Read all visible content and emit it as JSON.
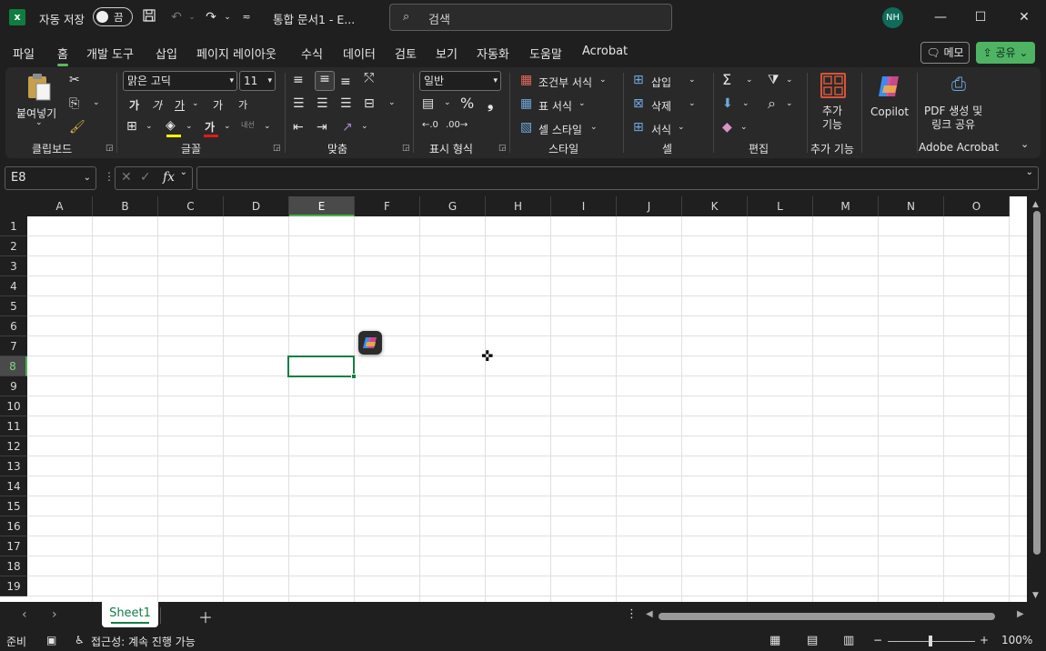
{
  "titlebar": {
    "autosave_label": "자동 저장",
    "autosave_state": "끔",
    "doc_title": "통합 문서1 - E...",
    "search_placeholder": "검색",
    "avatar_initials": "NH"
  },
  "tabs": [
    "파일",
    "홈",
    "개발 도구",
    "삽입",
    "페이지 레이아웃",
    "수식",
    "데이터",
    "검토",
    "보기",
    "자동화",
    "도움말",
    "Acrobat"
  ],
  "active_tab": "홈",
  "actions": {
    "memo": "메모",
    "share": "공유"
  },
  "ribbon": {
    "clipboard": {
      "label": "클립보드",
      "paste": "붙여넣기"
    },
    "font": {
      "label": "글꼴",
      "font_name": "맑은 고딕",
      "font_size": "11",
      "bold": "가",
      "italic": "가",
      "underline": "가",
      "grow": "가",
      "shrink": "가",
      "font_color": "가",
      "phonetic": "내선"
    },
    "alignment": {
      "label": "맞춤"
    },
    "number": {
      "label": "표시 형식",
      "format": "일반"
    },
    "styles": {
      "label": "스타일",
      "conditional": "조건부 서식",
      "table": "표 서식",
      "cell_styles": "셀 스타일"
    },
    "cells": {
      "label": "셀",
      "insert": "삽입",
      "delete": "삭제",
      "format": "서식"
    },
    "editing": {
      "label": "편집"
    },
    "addins": {
      "label": "추가 기능",
      "button": "추가\n기능"
    },
    "copilot": {
      "label": "Copilot"
    },
    "acrobat": {
      "label": "Adobe Acrobat",
      "button": "PDF 생성 및\n링크 공유"
    }
  },
  "formula_bar": {
    "name_box": "E8",
    "fx": "fx",
    "formula": ""
  },
  "grid": {
    "columns": [
      "A",
      "B",
      "C",
      "D",
      "E",
      "F",
      "G",
      "H",
      "I",
      "J",
      "K",
      "L",
      "M",
      "N",
      "O"
    ],
    "rows": [
      "1",
      "2",
      "3",
      "4",
      "5",
      "6",
      "7",
      "8",
      "9",
      "10",
      "11",
      "12",
      "13",
      "14",
      "15",
      "16",
      "17",
      "18",
      "19"
    ],
    "selected_column": "E",
    "selected_row": "8"
  },
  "sheets": {
    "tabs": [
      "Sheet1"
    ],
    "active": "Sheet1"
  },
  "statusbar": {
    "ready": "준비",
    "accessibility": "접근성: 계속 진행 가능",
    "zoom": "100%"
  },
  "colors": {
    "accent_green": "#137e43",
    "share_green": "#4fb364",
    "background": "#1f1f1f"
  }
}
